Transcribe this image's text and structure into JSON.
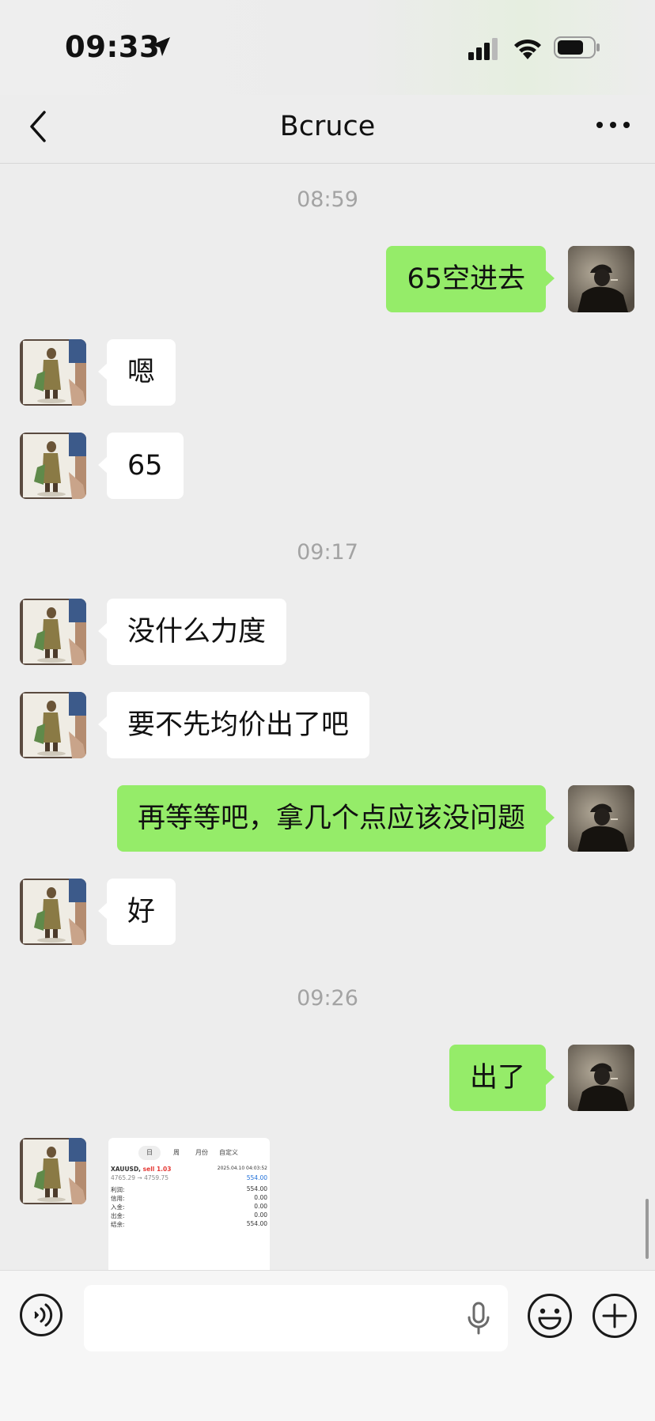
{
  "status_bar": {
    "time": "09:33"
  },
  "nav": {
    "title": "Bcruce"
  },
  "messages": {
    "ts1": "08:59",
    "m1": "65空进去",
    "m2": "嗯",
    "m3": "65",
    "ts2": "09:17",
    "m4": "没什么力度",
    "m5": "要不先均价出了吧",
    "m6": "再等等吧，拿几个点应该没问题",
    "m7": "好",
    "ts3": "09:26",
    "m8": "出了"
  },
  "image_message": {
    "tabs": [
      "日",
      "周",
      "月份",
      "自定义"
    ],
    "symbol": "XAUUSD,",
    "side": "sell 1.03",
    "datetime": "2025.04.10 04:03:52",
    "prices": "4765.29 → 4759.75",
    "pnl": "554.00",
    "rows": [
      {
        "label": "利润:",
        "value": "554.00"
      },
      {
        "label": "信用:",
        "value": "0.00"
      },
      {
        "label": "入金:",
        "value": "0.00"
      },
      {
        "label": "出金:",
        "value": "0.00"
      },
      {
        "label": "结余:",
        "value": "554.00"
      }
    ]
  },
  "colors": {
    "outgoing_bubble": "#95ec69",
    "incoming_bubble": "#ffffff",
    "background": "#ededed",
    "sell_red": "#e53935",
    "profit_blue": "#1e6fd9"
  },
  "icons": [
    "location-arrow-icon",
    "signal-icon",
    "wifi-icon",
    "battery-icon",
    "back-chevron-icon",
    "more-dots-icon",
    "voice-icon",
    "microphone-icon",
    "emoji-icon",
    "plus-icon"
  ]
}
